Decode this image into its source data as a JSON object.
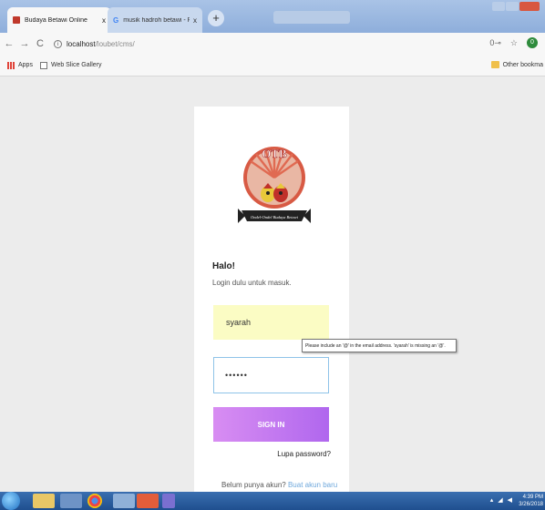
{
  "browser": {
    "tabs": [
      {
        "title": "Budaya Betawi Online",
        "close": "x"
      },
      {
        "title": "musik hadroh betawi - Penelusu",
        "close": "x"
      }
    ],
    "new_tab": "+",
    "address": {
      "host": "localhost",
      "path": "/loubet/cms/"
    },
    "nav": {
      "back": "←",
      "forward": "→",
      "reload": "C"
    },
    "right_icons": {
      "key": "0⊸",
      "star": "☆",
      "ext": "0"
    },
    "bookmarks": [
      {
        "label": "Apps"
      },
      {
        "label": "Web Slice Gallery"
      }
    ],
    "other_bookmarks": "Other bookma"
  },
  "login": {
    "heading": "Halo!",
    "subtitle": "Login dulu untuk masuk.",
    "email_value": "syarah",
    "password_value": "••••••",
    "signin_label": "SIGN IN",
    "forgot_label": "Lupa password?",
    "register_text": "Belum punya akun?",
    "register_link": "Buat akun baru"
  },
  "validation": {
    "tooltip": "Please include an '@' in the email address. 'syarah' is missing an '@'."
  },
  "logo": {
    "text": "OTB",
    "banner": "Ondel-Ondel Budaya Betawi"
  },
  "taskbar": {
    "clock_time": "4:39 PM",
    "clock_date": "3/26/2018"
  },
  "colors": {
    "signin_gradient_start": "#d88df2",
    "signin_gradient_end": "#b067ee",
    "email_bg": "#fbfcc4",
    "link": "#6fa8dc",
    "logo_ring": "#d85a44"
  }
}
